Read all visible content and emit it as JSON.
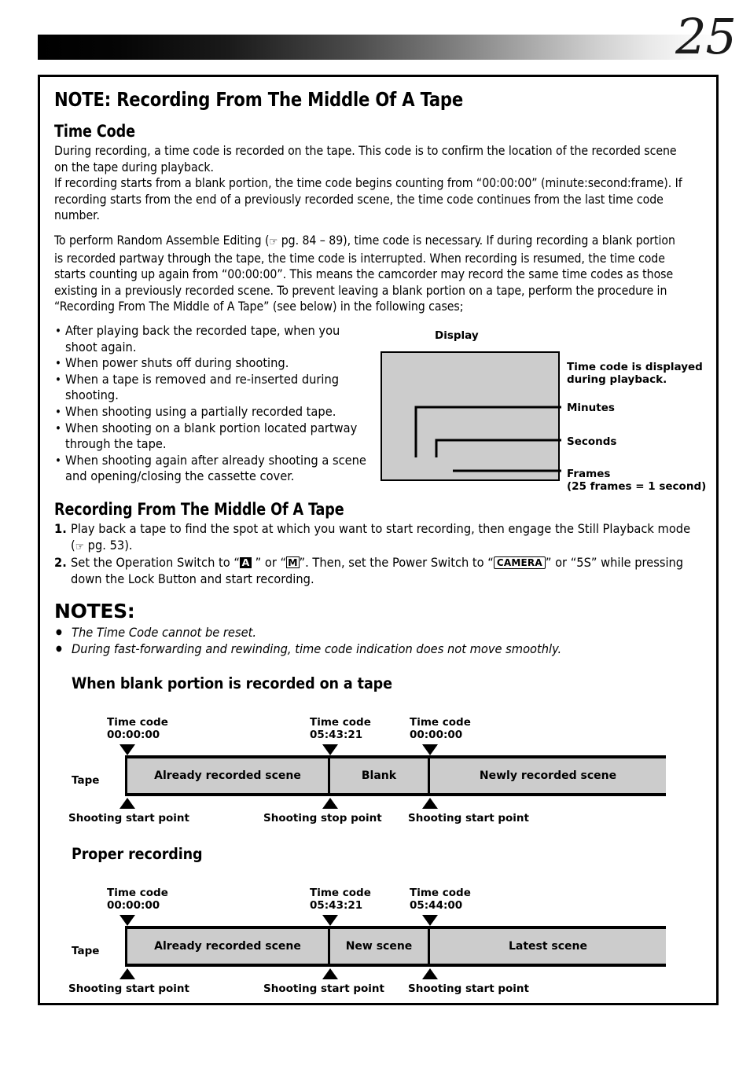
{
  "page": {
    "number": "25"
  },
  "title": "NOTE: Recording From The Middle Of A Tape",
  "time_code_section": {
    "heading": "Time Code",
    "paragraph1": "During recording, a time code is recorded on the tape. This code is to confirm the location of the recorded scene on the tape during playback.",
    "paragraph2": "If recording starts from a blank portion, the time code begins counting from “00:00:00” (minute:second:frame). If recording starts from the end of a previously recorded scene, the time code continues from the last time code number.",
    "paragraph3_part1": "To perform Random Assemble Editing (",
    "paragraph3_ref": "pg. 84 – 89",
    "paragraph3_part2": "), time code is necessary. If during recording a blank portion is recorded partway through the tape, the time code is interrupted. When recording is resumed, the time code starts counting up again from “00:00:00”. This means the camcorder may record the same time codes as those existing in a previously recorded scene. To prevent leaving a blank portion on a tape, perform the procedure in “Recording From The Middle of A Tape” (see below) in the following cases;",
    "bullets": [
      "After playing back the recorded tape, when you shoot again.",
      "When power shuts off during shooting.",
      "When a tape is removed and re-inserted during shooting.",
      "When shooting using a partially recorded tape.",
      "When shooting on a blank portion located partway through the tape.",
      "When shooting again after already shooting a scene and opening/closing the cassette cover."
    ]
  },
  "display_diagram": {
    "caption": "Display",
    "note_line1": "Time code is displayed",
    "note_line2": "during playback.",
    "labels": {
      "minutes": "Minutes",
      "seconds": "Seconds",
      "frames": "Frames",
      "frames_sub": "(25 frames = 1 second)"
    },
    "box_fill": "#cccccc"
  },
  "procedure_section": {
    "heading": "Recording From The Middle Of A Tape",
    "step1": {
      "num": "1.",
      "text_part1": "Play back a tape to find the spot at which you want to start recording, then engage the Still Playback mode (",
      "ref": "pg. 53",
      "text_part2": ")."
    },
    "step2": {
      "num": "2.",
      "text_part1": "Set the Operation Switch to “",
      "badge_a": "A",
      "text_part2": "” or “",
      "badge_m": "M",
      "text_part3": "”. Then, set the Power Switch to “",
      "badge_camera": "CAMERA",
      "text_part4": "” or “5S” while pressing down the Lock Button and start recording."
    }
  },
  "notes_section": {
    "heading": "NOTES:",
    "items": [
      "The Time Code cannot be reset.",
      "During fast-forwarding and rewinding, time code indication does not move smoothly."
    ]
  },
  "diagram_blank": {
    "title": "When blank portion is recorded on a tape",
    "tape_word": "Tape",
    "tape_fill": "#cccccc",
    "markers": [
      {
        "tc_line1": "Time code",
        "tc_line2": "00:00:00",
        "point": "Shooting start point"
      },
      {
        "tc_line1": "Time code",
        "tc_line2": "05:43:21",
        "point": "Shooting stop point"
      },
      {
        "tc_line1": "Time code",
        "tc_line2": "00:00:00",
        "point": "Shooting start point"
      }
    ],
    "segments": [
      "Already recorded scene",
      "Blank",
      "Newly recorded scene"
    ]
  },
  "diagram_proper": {
    "title": "Proper recording",
    "tape_word": "Tape",
    "tape_fill": "#cccccc",
    "markers": [
      {
        "tc_line1": "Time code",
        "tc_line2": "00:00:00",
        "point": "Shooting start point"
      },
      {
        "tc_line1": "Time code",
        "tc_line2": "05:43:21",
        "point": "Shooting start point"
      },
      {
        "tc_line1": "Time code",
        "tc_line2": "05:44:00",
        "point": "Shooting start point"
      }
    ],
    "segments": [
      "Already recorded scene",
      "New scene",
      "Latest scene"
    ]
  },
  "icons": {
    "pointing_hand": "☞"
  }
}
